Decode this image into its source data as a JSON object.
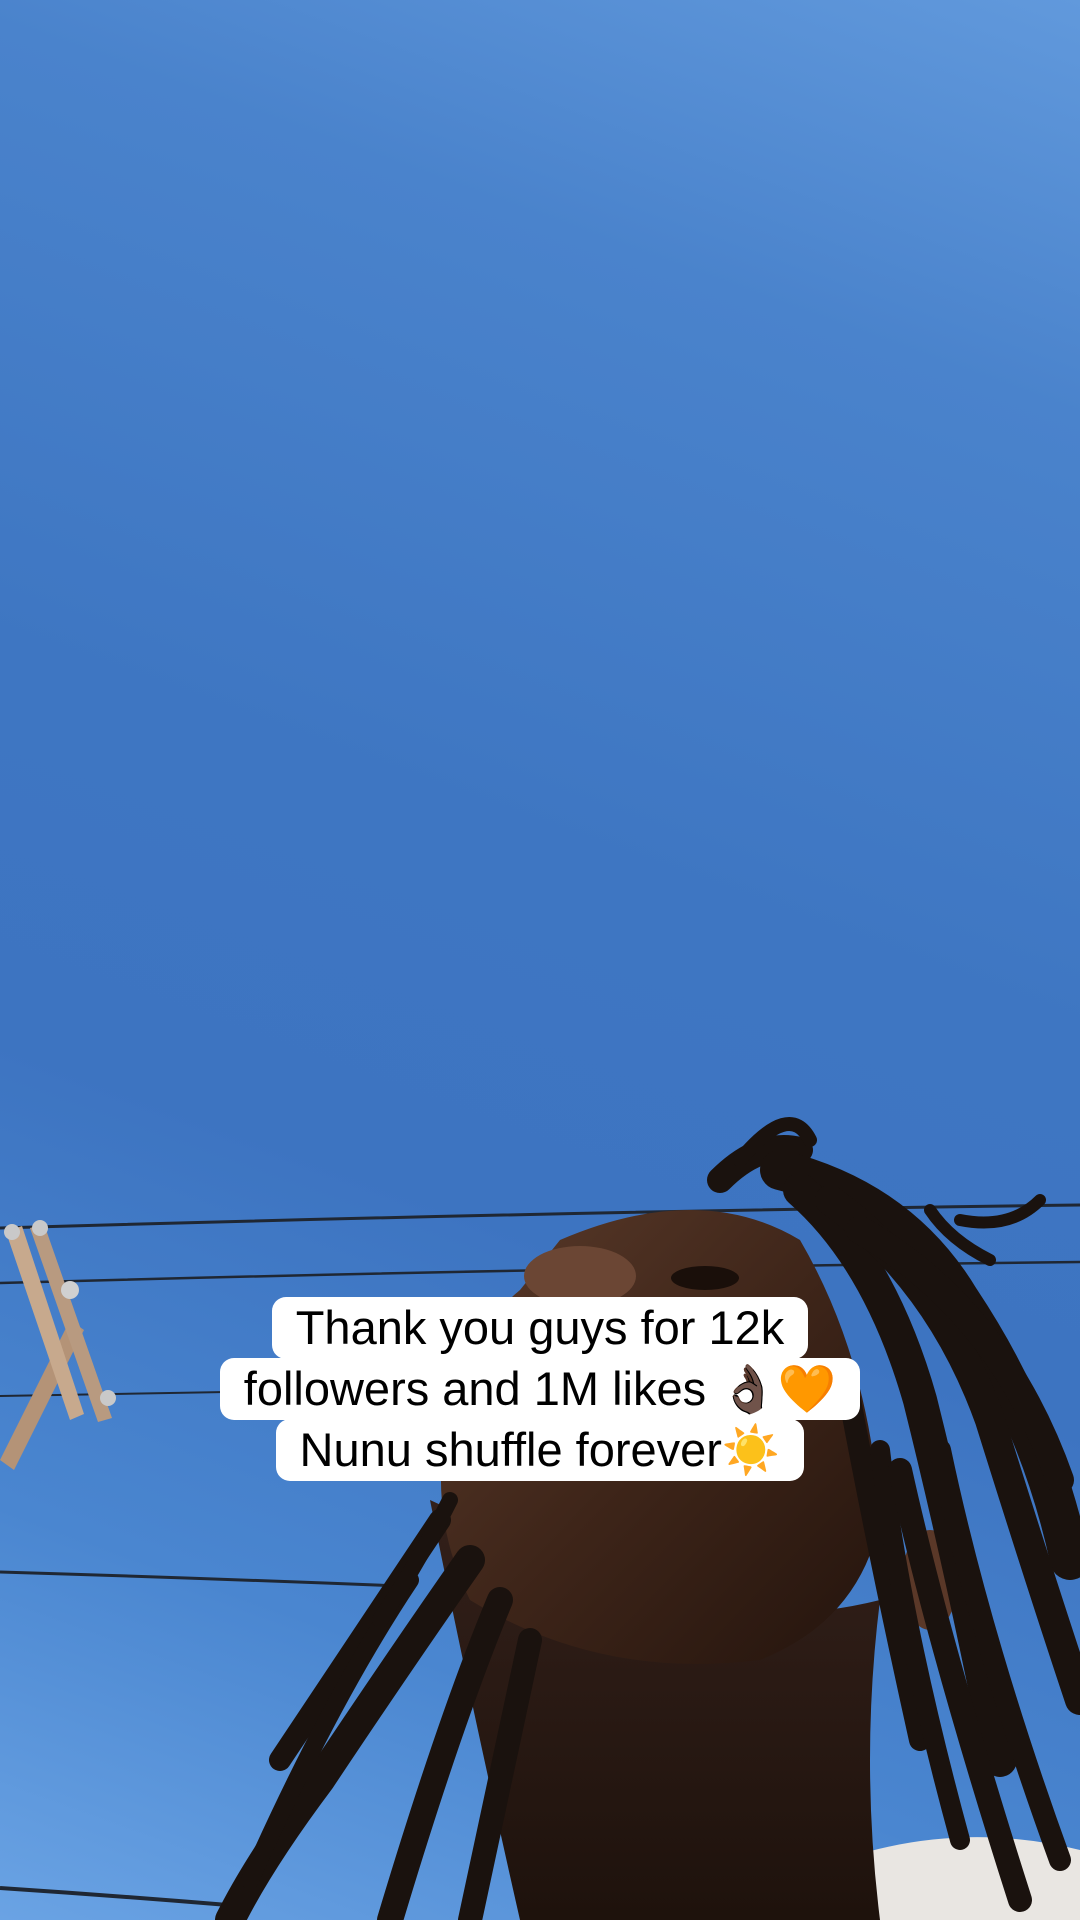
{
  "video": {
    "description_free_caption": {
      "lines": [
        "Thank you guys for 12k",
        "followers and 1M likes 👌🏿🧡",
        "Nunu shuffle forever☀️"
      ]
    }
  },
  "colors": {
    "sky": "#3e76c2",
    "caption_background": "#ffffff",
    "caption_text": "#000000"
  }
}
